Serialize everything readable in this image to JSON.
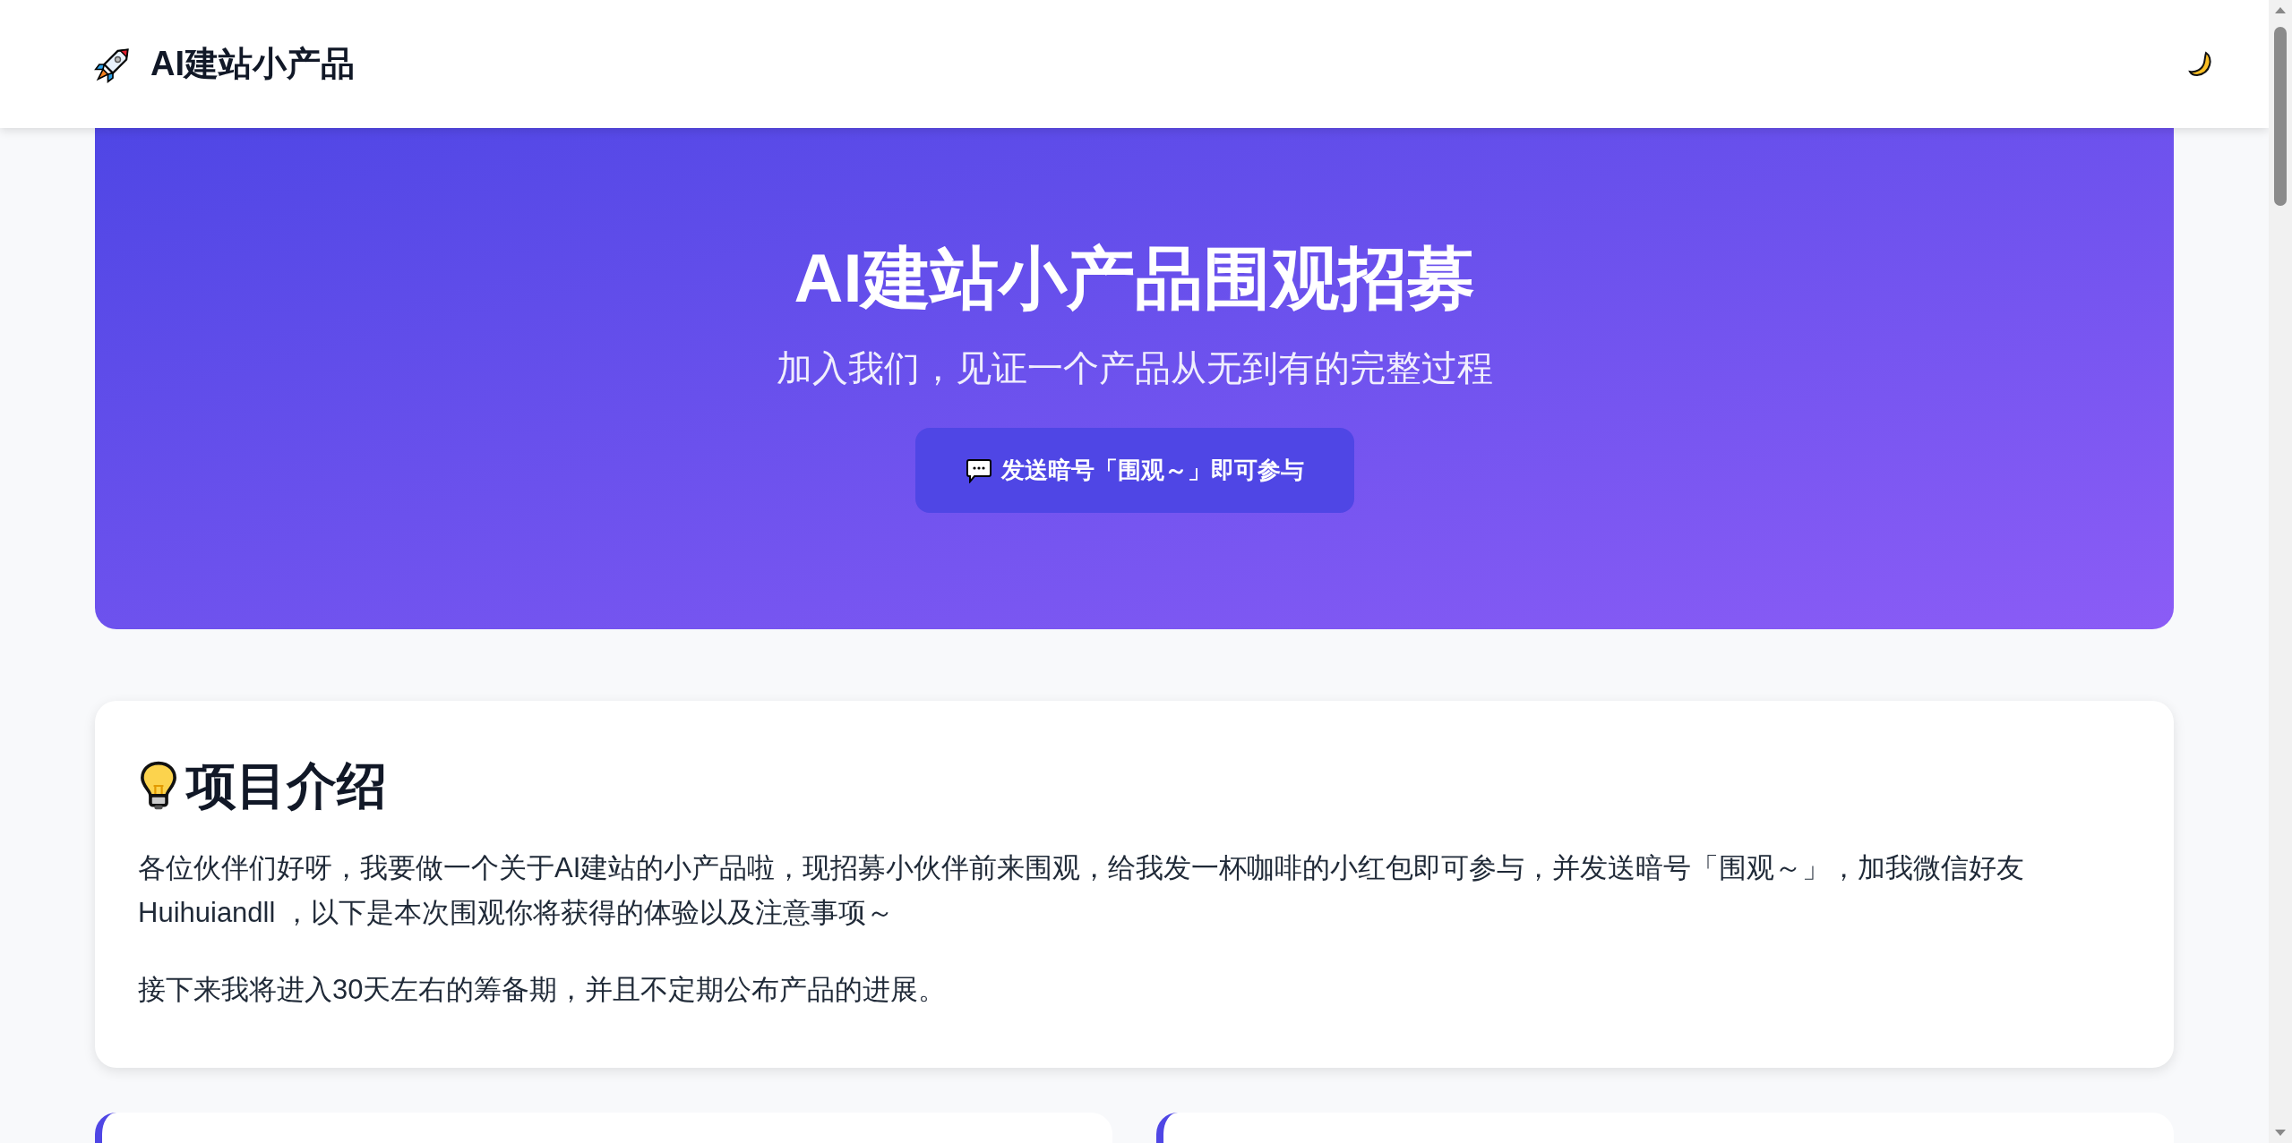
{
  "header": {
    "title": "AI建站小产品"
  },
  "hero": {
    "title": "AI建站小产品围观招募",
    "subtitle": "加入我们，见证一个产品从无到有的完整过程",
    "button": "发送暗号「围观～」即可参与"
  },
  "intro": {
    "heading": "项目介绍",
    "paragraphs": [
      "各位伙伴们好呀，我要做一个关于AI建站的小产品啦，现招募小伙伴前来围观，给我发一杯咖啡的小红包即可参与，并发送暗号「围观～」，加我微信好友 Huihuiandll ，以下是本次围观你将获得的体验以及注意事项～",
      "接下来我将进入30天左右的筹备期，并且不定期公布产品的进展。"
    ]
  }
}
